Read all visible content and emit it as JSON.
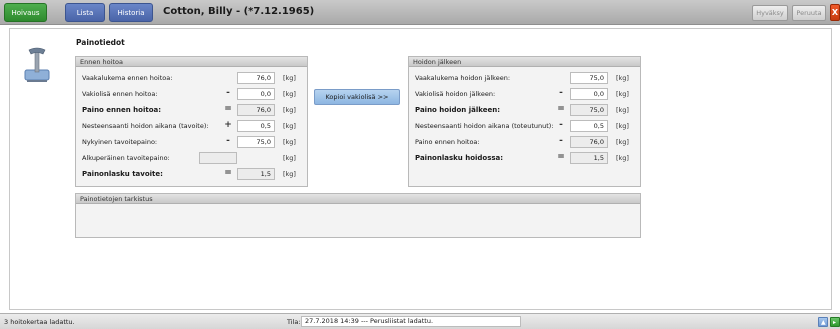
{
  "topbar": {
    "tabs": [
      "Hoivaus",
      "Lista",
      "Historia"
    ],
    "patient_title": "Cotton, Billy - (*7.12.1965)",
    "accept_label": "Hyväksy",
    "cancel_label": "Peruuta",
    "close_label": "X"
  },
  "page": {
    "heading": "Painotiedot"
  },
  "before": {
    "header": "Ennen hoitoa",
    "rows": [
      {
        "label": "Vaakalukema ennen hoitoa:",
        "op": "",
        "value": "76,0",
        "unit": "[kg]"
      },
      {
        "label": "Vakiolisä ennen hoitoa:",
        "op": "-",
        "value": "0,0",
        "unit": "[kg]"
      },
      {
        "label": "Paino ennen hoitoa:",
        "op": "=",
        "value": "76,0",
        "unit": "[kg]"
      },
      {
        "label": "Nesteensaanti hoidon aikana (tavoite):",
        "op": "+",
        "value": "0,5",
        "unit": "[kg]"
      },
      {
        "label": "Nykyinen tavoitepaino:",
        "op": "-",
        "value": "75,0",
        "unit": "[kg]"
      },
      {
        "label": "Alkuperäinen tavoitepaino:",
        "op": "",
        "value": "",
        "unit": "[kg]"
      },
      {
        "label": "Painonlasku tavoite:",
        "op": "=",
        "value": "1,5",
        "unit": "[kg]"
      }
    ]
  },
  "copy_button": "Kopioi vakiolisä >>",
  "after": {
    "header": "Hoidon jälkeen",
    "rows": [
      {
        "label": "Vaakalukema hoidon jälkeen:",
        "op": "",
        "value": "75,0",
        "unit": "[kg]"
      },
      {
        "label": "Vakiolisä hoidon jälkeen:",
        "op": "-",
        "value": "0,0",
        "unit": "[kg]"
      },
      {
        "label": "Paino hoidon jälkeen:",
        "op": "=",
        "value": "75,0",
        "unit": "[kg]"
      },
      {
        "label": "Nesteensaanti hoidon aikana (toteutunut):",
        "op": "-",
        "value": "0,5",
        "unit": "[kg]"
      },
      {
        "label": "Paino ennen hoitoa:",
        "op": "-",
        "value": "76,0",
        "unit": "[kg]"
      },
      {
        "label": "Painonlasku hoidossa:",
        "op": "=",
        "value": "1,5",
        "unit": "[kg]"
      }
    ]
  },
  "check_panel": {
    "header": "Painotietojen tarkistus"
  },
  "statusbar": {
    "left": "3 hoitokertaa ladattu.",
    "tila_label": "Tila:",
    "tila_value": "27.7.2018 14:39 --- Perusliistat ladattu."
  },
  "colors": {
    "accent_green": "#2e8a2e",
    "accent_blue": "#4a64a8",
    "close_red": "#c63a0e",
    "copy_button": "#8db6e2"
  }
}
